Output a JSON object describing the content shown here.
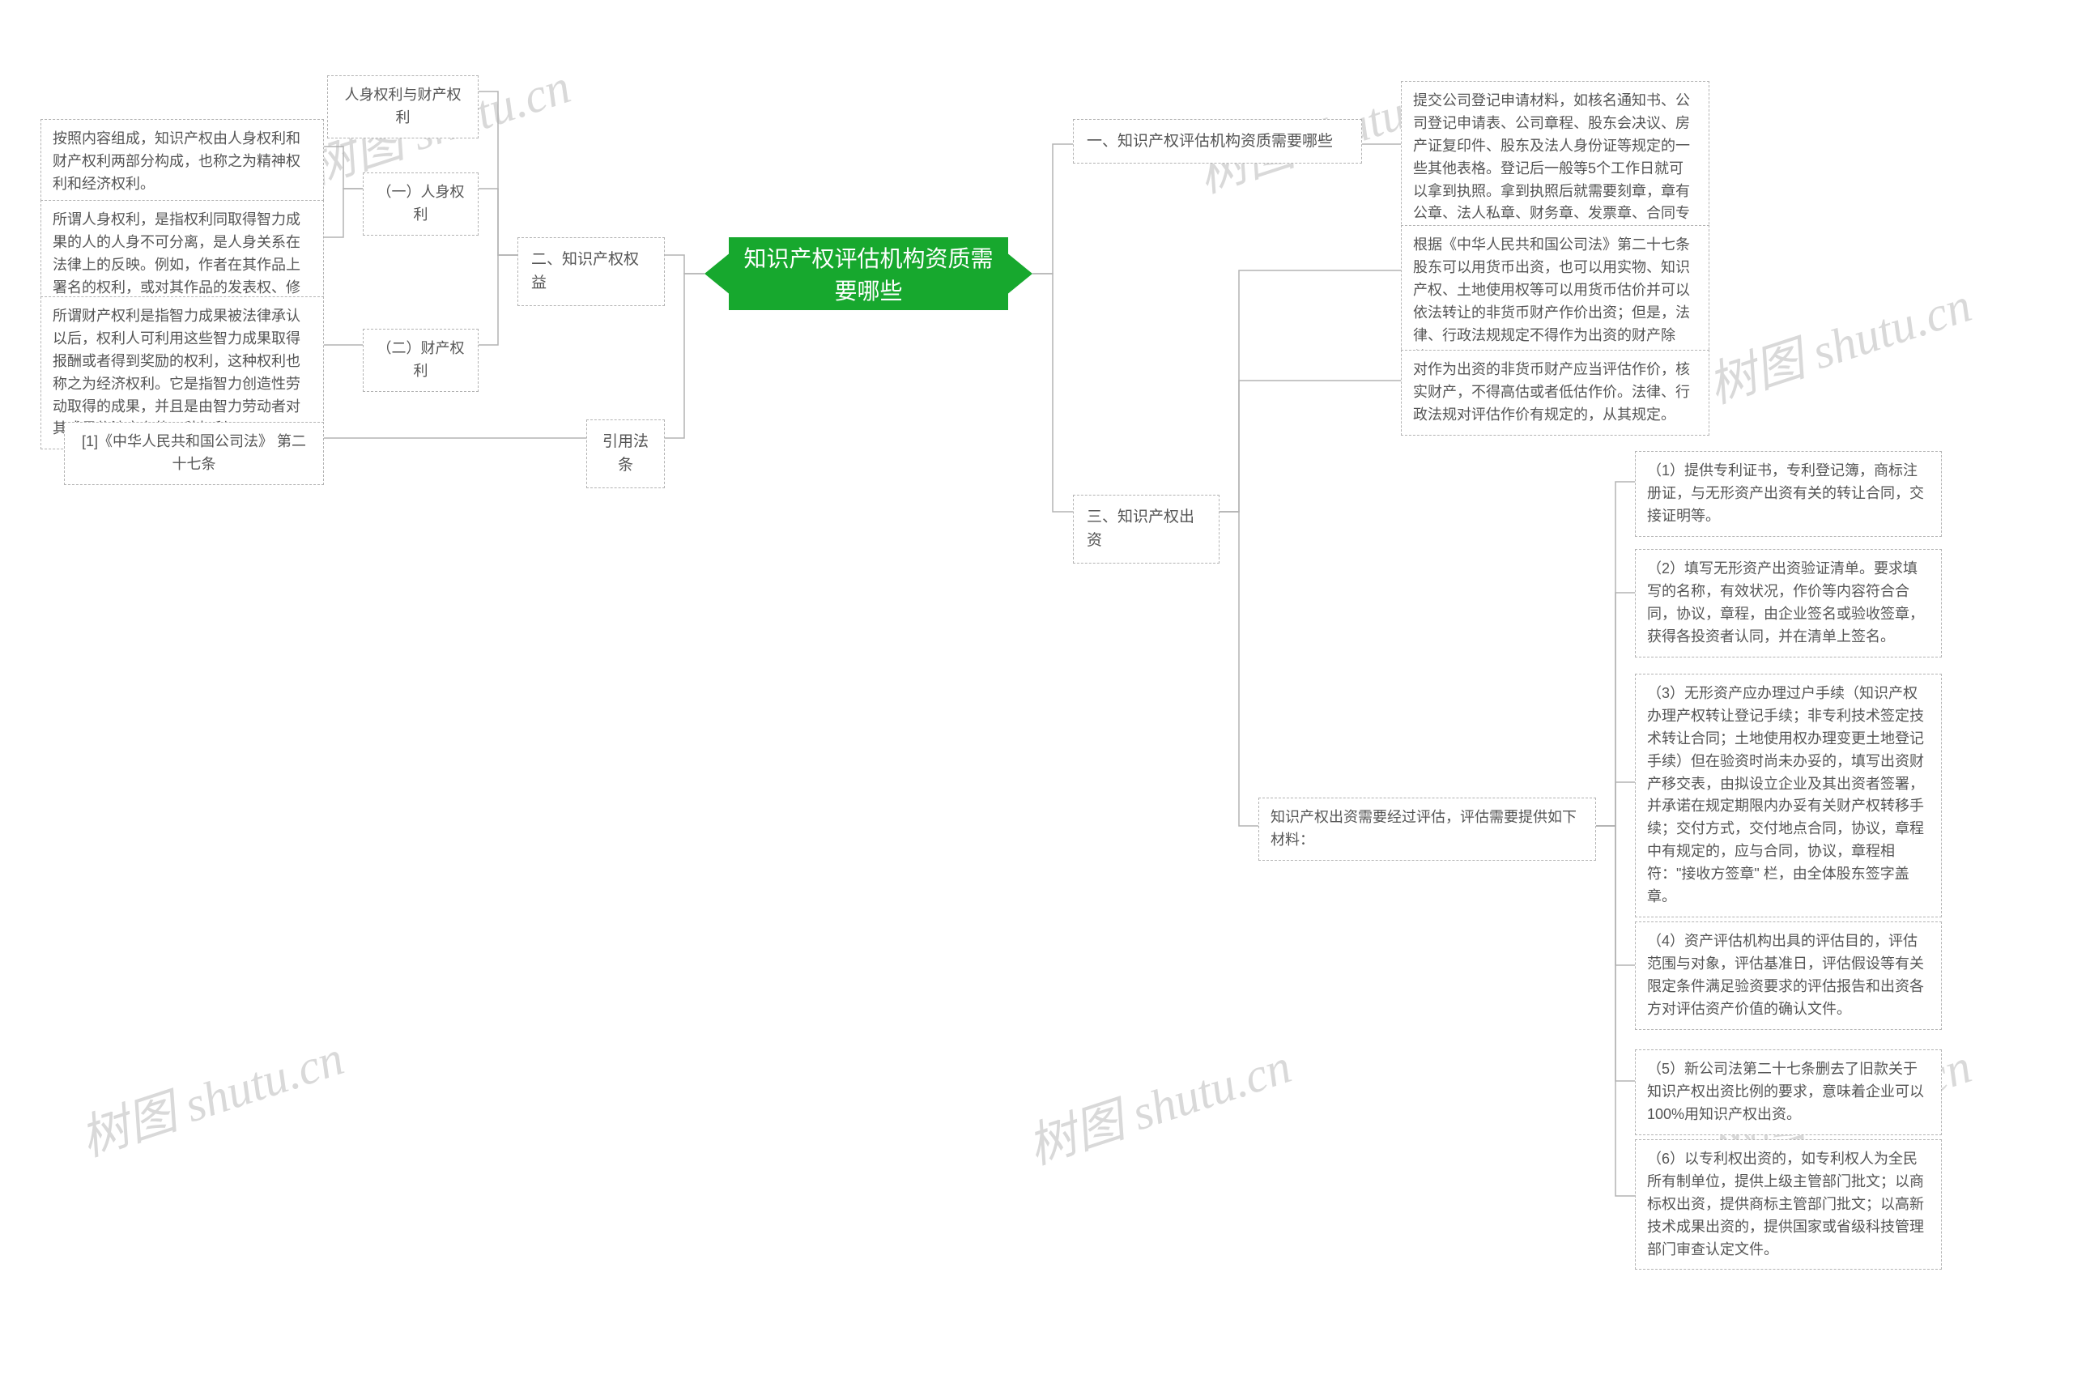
{
  "root": {
    "title_line1": "知识产权评估机构资质需",
    "title_line2": "要哪些"
  },
  "watermark": "树图 shutu.cn",
  "left": {
    "section2": {
      "title": "二、知识产权权益",
      "item0": "人身权利与财产权利",
      "sub1": {
        "label": "（一）人身权利",
        "d1": "按照内容组成，知识产权由人身权利和财产权利两部分构成，也称之为精神权利和经济权利。",
        "d2": "所谓人身权利，是指权利同取得智力成果的人的人身不可分离，是人身关系在法律上的反映。例如，作者在其作品上署名的权利，或对其作品的发表权、修改权等，即为精神权利。"
      },
      "sub2": {
        "label": "（二）财产权利",
        "d1": "所谓财产权利是指智力成果被法律承认以后，权利人可利用这些智力成果取得报酬或者得到奖励的权利，这种权利也称之为经济权利。它是指智力创造性劳动取得的成果，并且是由智力劳动者对其成果依法享有的一种权利。"
      }
    },
    "citation": {
      "title": "引用法条",
      "ref": "[1]《中华人民共和国公司法》 第二十七条"
    }
  },
  "right": {
    "section1": {
      "title": "一、知识产权评估机构资质需要哪些",
      "d1": "提交公司登记申请材料，如核名通知书、公司登记申请表、公司章程、股东会决议、房产证复印件、股东及法人身份证等规定的一些其他表格。登记后一般等5个工作日就可以拿到执照。拿到执照后就需要刻章，章有公章、法人私章、财务章、发票章、合同专用章等。"
    },
    "section3": {
      "title": "三、知识产权出资",
      "p1": "根据《中华人民共和国公司法》第二十七条股东可以用货币出资，也可以用实物、知识产权、土地使用权等可以用货币估价并可以依法转让的非货币财产作价出资；但是，法律、行政法规规定不得作为出资的财产除外。",
      "p2": "对作为出资的非货币财产应当评估作价，核实财产，不得高估或者低估作价。法律、行政法规对评估作价有规定的，从其规定。",
      "eval": {
        "intro": "知识产权出资需要经过评估，评估需要提供如下材料：",
        "m1": "（1）提供专利证书，专利登记簿，商标注册证，与无形资产出资有关的转让合同，交接证明等。",
        "m2": "（2）填写无形资产出资验证清单。要求填写的名称，有效状况，作价等内容符合合同，协议，章程，由企业签名或验收签章，获得各投资者认同，并在清单上签名。",
        "m3": "（3）无形资产应办理过户手续（知识产权办理产权转让登记手续；非专利技术签定技术转让合同；土地使用权办理变更土地登记手续）但在验资时尚未办妥的，填写出资财产移交表，由拟设立企业及其出资者签署，并承诺在规定期限内办妥有关财产权转移手续；交付方式，交付地点合同，协议，章程中有规定的，应与合同，协议，章程相符：\"接收方签章\" 栏，由全体股东签字盖章。",
        "m4": "（4）资产评估机构出具的评估目的，评估范围与对象，评估基准日，评估假设等有关限定条件满足验资要求的评估报告和出资各方对评估资产价值的确认文件。",
        "m5": "（5）新公司法第二十七条删去了旧款关于知识产权出资比例的要求，意味着企业可以100%用知识产权出资。",
        "m6": "（6）以专利权出资的，如专利权人为全民所有制单位，提供上级主管部门批文；以商标权出资，提供商标主管部门批文；以高新技术成果出资的，提供国家或省级科技管理部门审查认定文件。"
      }
    }
  }
}
